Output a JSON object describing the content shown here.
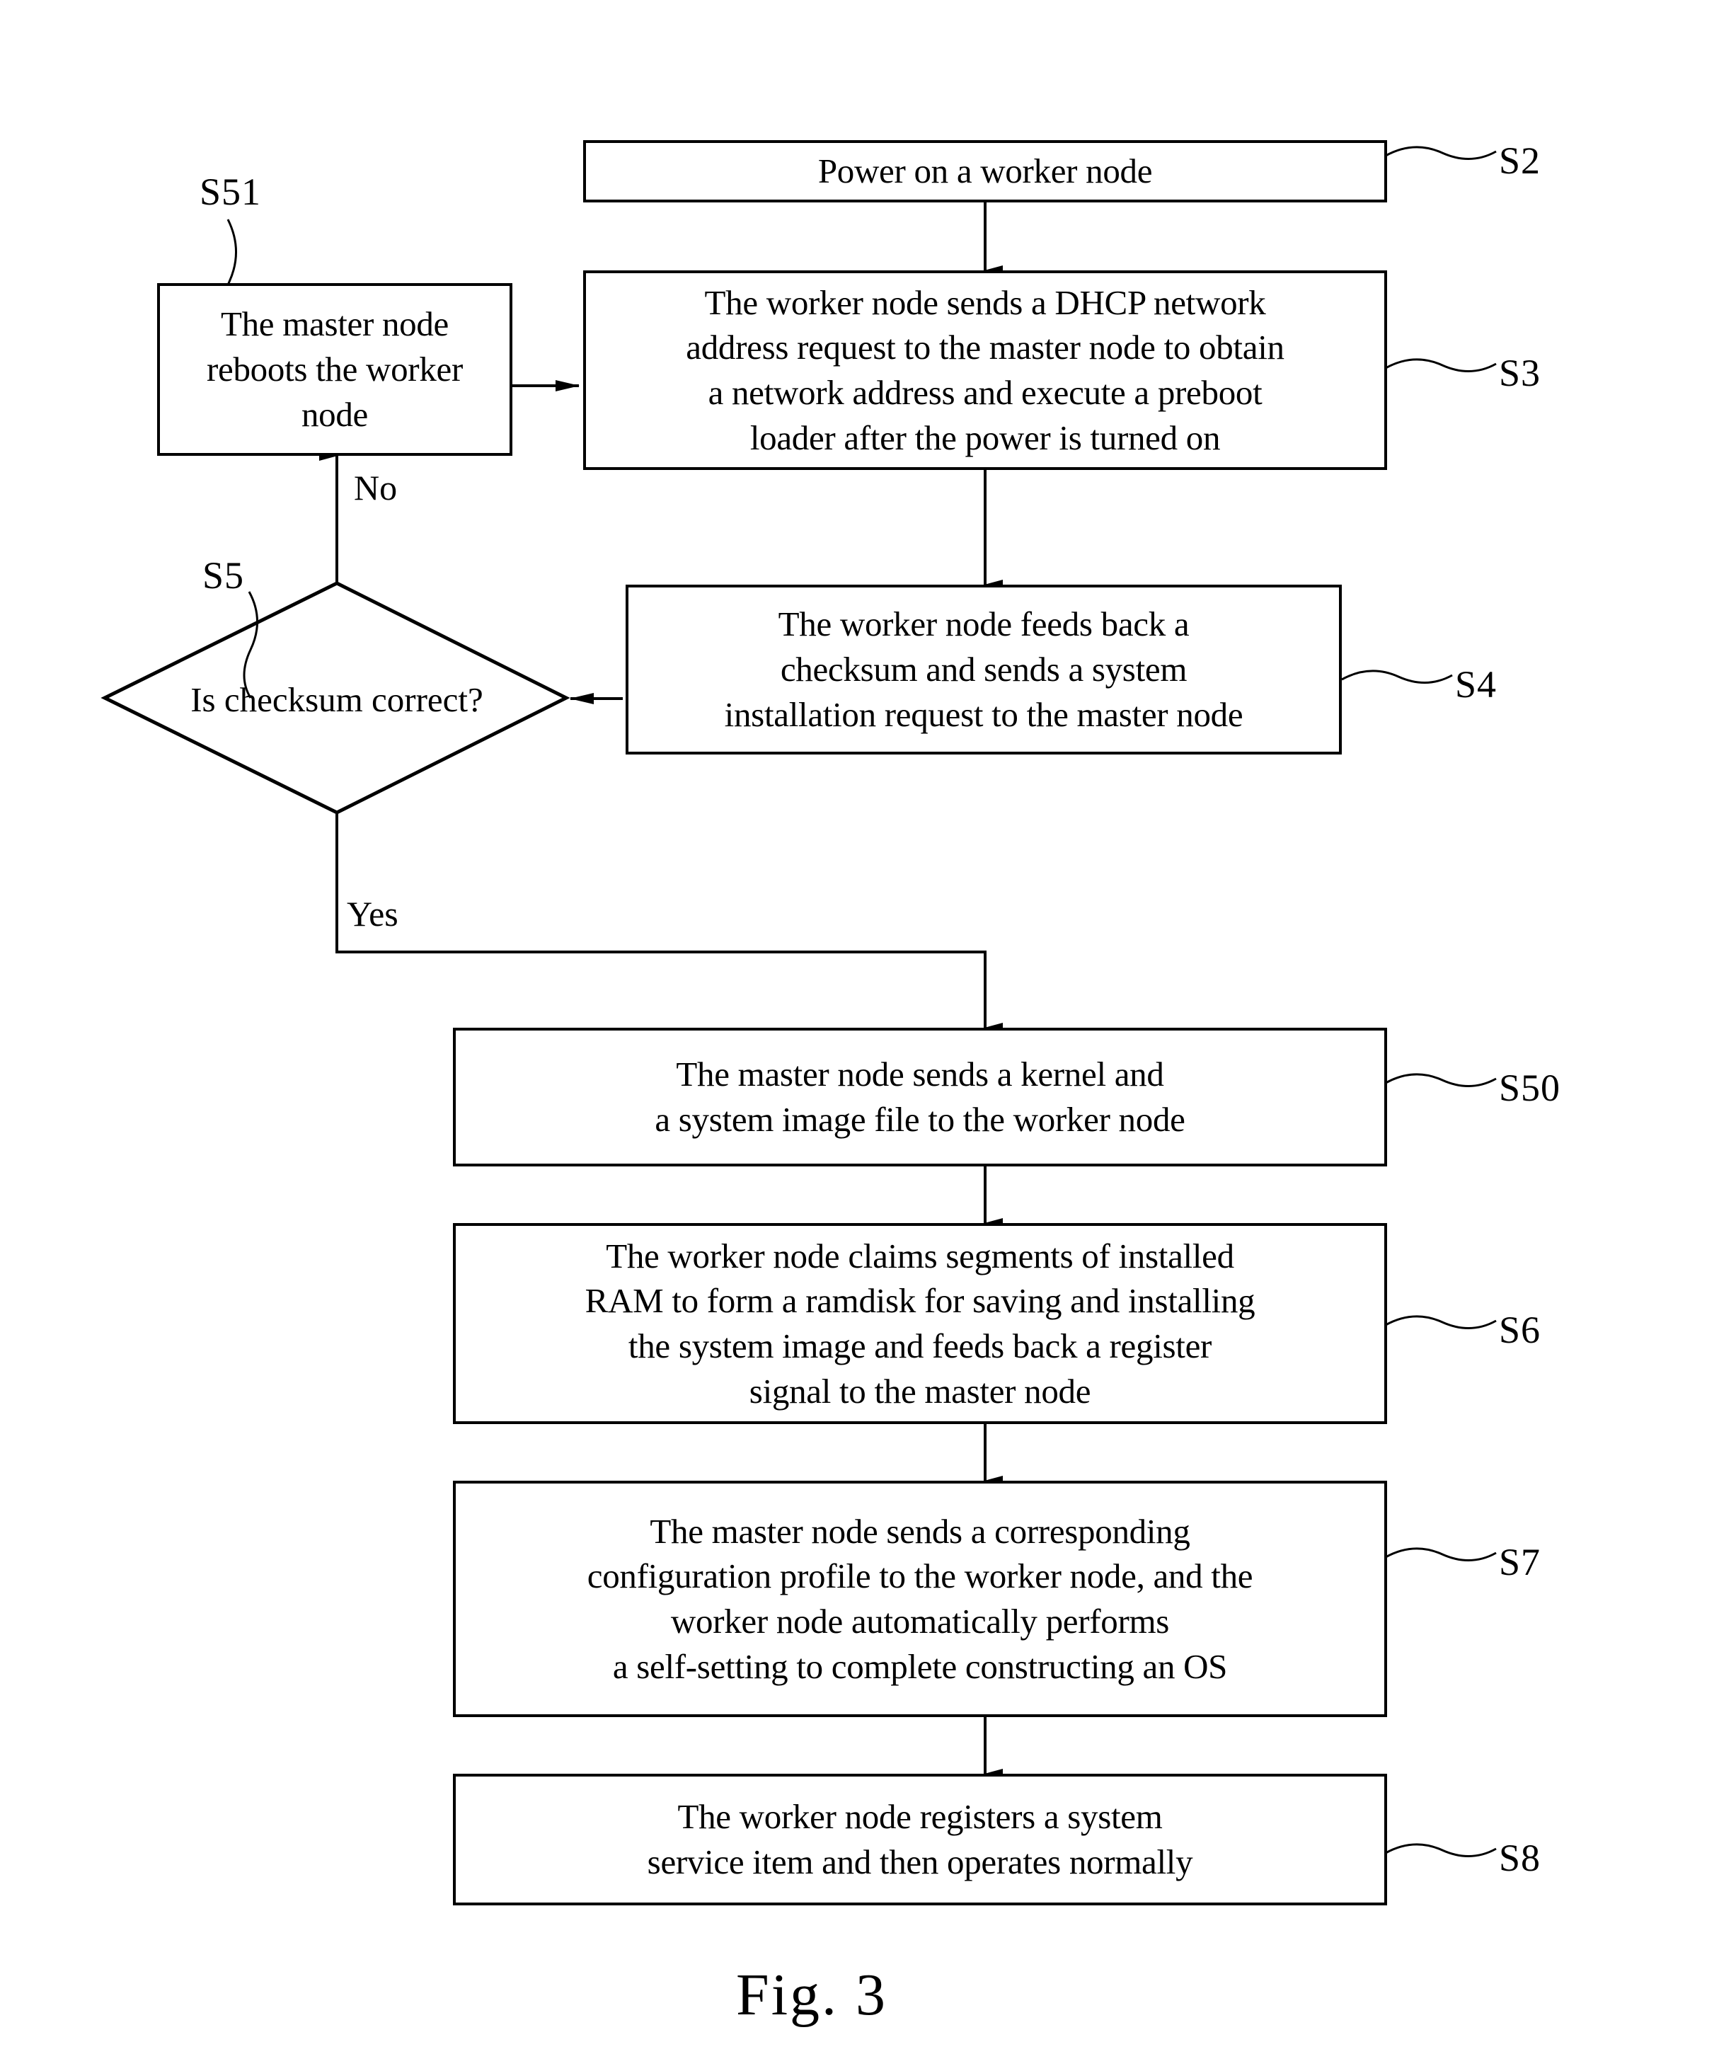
{
  "figure": {
    "caption": "Fig. 3",
    "title": "Worker node system installation flowchart"
  },
  "nodes": {
    "s2": {
      "ref": "S2",
      "text": "Power on a worker node"
    },
    "s3": {
      "ref": "S3",
      "text": "The worker node sends a DHCP network\naddress request to the master node to obtain\na network address and execute a preboot\nloader after the power is turned on"
    },
    "s4": {
      "ref": "S4",
      "text": "The worker node feeds back a\nchecksum and sends a system\ninstallation request to the master node"
    },
    "s5": {
      "ref": "S5",
      "text": "Is checksum correct?"
    },
    "s51": {
      "ref": "S51",
      "text": "The master node\nreboots the worker\nnode"
    },
    "s50": {
      "ref": "S50",
      "text": "The master node sends a kernel and\na system image file to the worker node"
    },
    "s6": {
      "ref": "S6",
      "text": "The worker node claims segments of installed\nRAM to form a ramdisk for saving and installing\nthe system image and feeds back a register\nsignal to the master node"
    },
    "s7": {
      "ref": "S7",
      "text": "The master node sends a corresponding\nconfiguration profile to the worker node, and the\nworker node automatically performs\na self-setting to complete constructing an OS"
    },
    "s8": {
      "ref": "S8",
      "text": "The worker node registers a system\nservice item and then operates normally"
    }
  },
  "branches": {
    "no_label": "No",
    "yes_label": "Yes"
  },
  "colors": {
    "ink": "#000000",
    "paper": "#ffffff"
  }
}
